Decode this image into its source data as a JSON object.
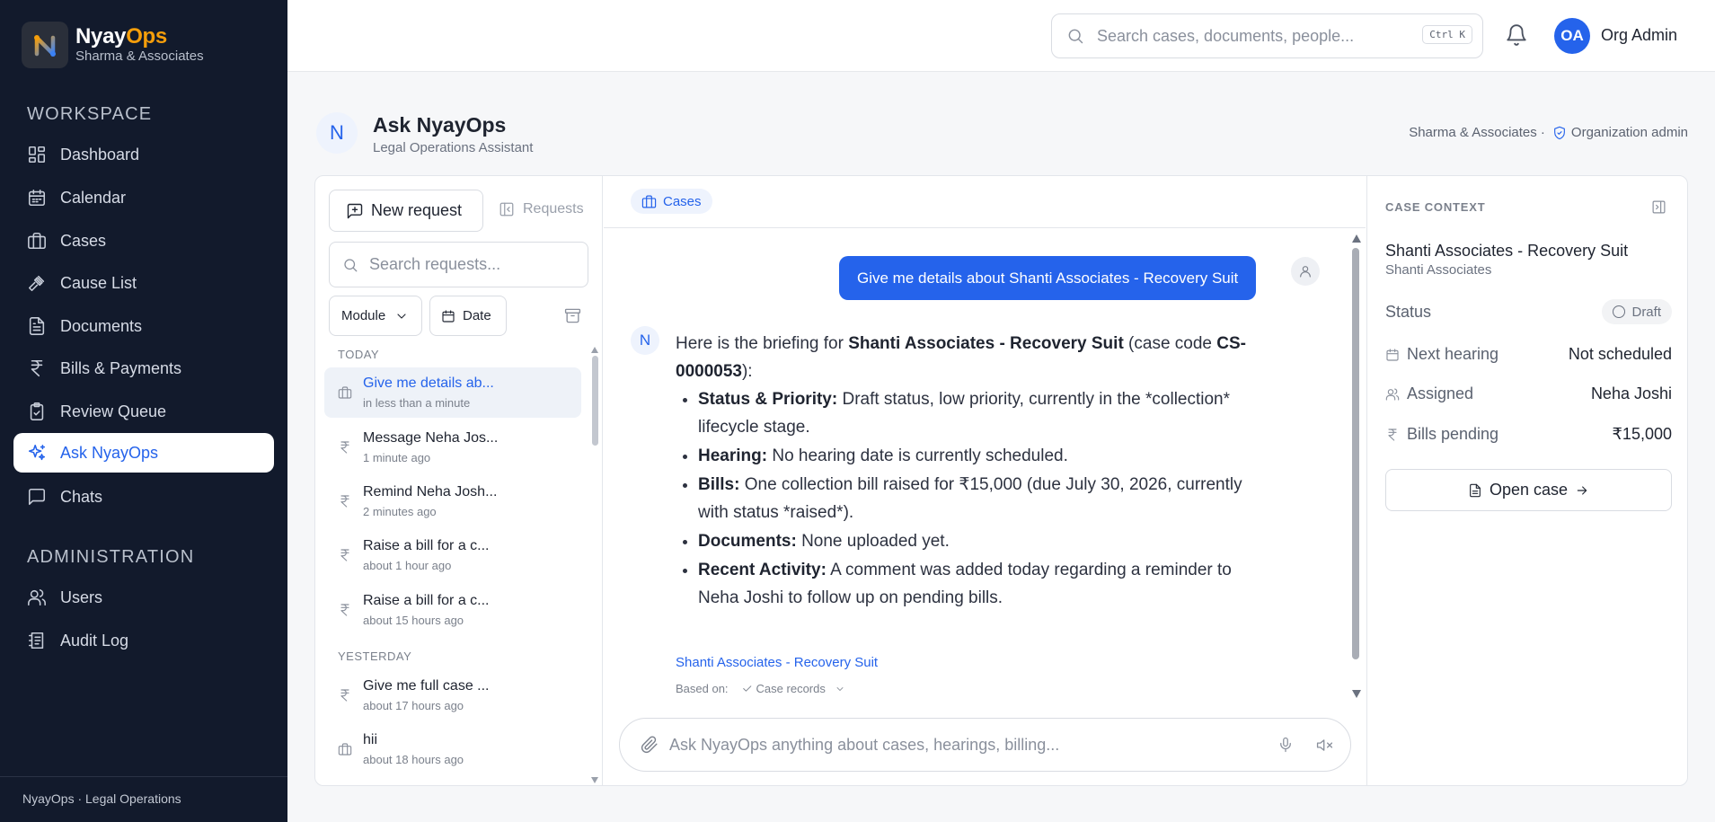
{
  "app": {
    "brand_prefix": "Nyay",
    "brand_suffix": "Ops",
    "org": "Sharma & Associates",
    "accent_color": "#2563eb",
    "brand_color": "#f59e0b"
  },
  "sidebar": {
    "workspace_label": "WORKSPACE",
    "admin_label": "ADMINISTRATION",
    "workspace_items": [
      {
        "label": "Dashboard",
        "icon": "dashboard-icon"
      },
      {
        "label": "Calendar",
        "icon": "calendar-icon"
      },
      {
        "label": "Cases",
        "icon": "briefcase-icon"
      },
      {
        "label": "Cause List",
        "icon": "gavel-icon"
      },
      {
        "label": "Documents",
        "icon": "document-icon"
      },
      {
        "label": "Bills & Payments",
        "icon": "rupee-icon"
      },
      {
        "label": "Review Queue",
        "icon": "clipboard-check-icon"
      },
      {
        "label": "Ask NyayOps",
        "icon": "sparkles-icon",
        "active": true
      },
      {
        "label": "Chats",
        "icon": "chat-icon"
      }
    ],
    "admin_items": [
      {
        "label": "Users",
        "icon": "users-icon"
      },
      {
        "label": "Audit Log",
        "icon": "audit-log-icon"
      }
    ],
    "footer": "NyayOps · Legal Operations"
  },
  "topbar": {
    "search_placeholder": "Search cases, documents, people...",
    "shortcut": "Ctrl K",
    "user_initials": "OA",
    "user_name": "Org Admin"
  },
  "page": {
    "icon_letter": "N",
    "title": "Ask NyayOps",
    "subtitle": "Legal Operations Assistant",
    "org": "Sharma & Associates ·",
    "role": "Organization admin"
  },
  "requests": {
    "new_label": "New request",
    "toggle_label": "Requests",
    "search_placeholder": "Search requests...",
    "filter_module": "Module",
    "filter_date": "Date",
    "today_label": "TODAY",
    "yesterday_label": "YESTERDAY",
    "today_items": [
      {
        "title": "Give me details ab...",
        "time": "in less than a minute",
        "icon": "briefcase-icon",
        "active": true
      },
      {
        "title": "Message Neha Jos...",
        "time": "1 minute ago",
        "icon": "rupee-icon"
      },
      {
        "title": "Remind Neha Josh...",
        "time": "2 minutes ago",
        "icon": "rupee-icon"
      },
      {
        "title": "Raise a bill for a c...",
        "time": "about 1 hour ago",
        "icon": "rupee-icon"
      },
      {
        "title": "Raise a bill for a c...",
        "time": "about 15 hours ago",
        "icon": "rupee-icon"
      }
    ],
    "yesterday_items": [
      {
        "title": "Give me full case ...",
        "time": "about 17 hours ago",
        "icon": "rupee-icon"
      },
      {
        "title": "hii",
        "time": "about 18 hours ago",
        "icon": "briefcase-icon"
      }
    ]
  },
  "chat": {
    "module_chip": "Cases",
    "user_message": "Give me details about Shanti Associates - Recovery Suit",
    "bot_avatar": "N",
    "response": {
      "intro_prefix": "Here is the briefing for ",
      "intro_case": "Shanti Associates - Recovery Suit",
      "intro_mid": " (case code ",
      "intro_code": "CS-0000053",
      "intro_suffix": "):",
      "bullets": [
        {
          "label": "Status & Priority:",
          "text": " Draft status, low priority, currently in the *collection* lifecycle stage."
        },
        {
          "label": "Hearing:",
          "text": " No hearing date is currently scheduled."
        },
        {
          "label": "Bills:",
          "text": " One collection bill raised for ₹15,000 (due July 30, 2026, currently with status *raised*)."
        },
        {
          "label": "Documents:",
          "text": " None uploaded yet."
        },
        {
          "label": "Recent Activity:",
          "text": " A comment was added today regarding a reminder to Neha Joshi to follow up on pending bills."
        }
      ]
    },
    "source_link": "Shanti Associates - Recovery Suit",
    "based_on_label": "Based on:",
    "based_on_value": "Case records",
    "input_placeholder": "Ask NyayOps anything about cases, hearings, billing..."
  },
  "context": {
    "label": "CASE CONTEXT",
    "case_title": "Shanti Associates - Recovery Suit",
    "client": "Shanti Associates",
    "status_label": "Status",
    "status_value": "Draft",
    "hearing_label": "Next hearing",
    "hearing_value": "Not scheduled",
    "assigned_label": "Assigned",
    "assigned_value": "Neha Joshi",
    "bills_label": "Bills pending",
    "bills_value": "₹15,000",
    "open_label": "Open case"
  }
}
